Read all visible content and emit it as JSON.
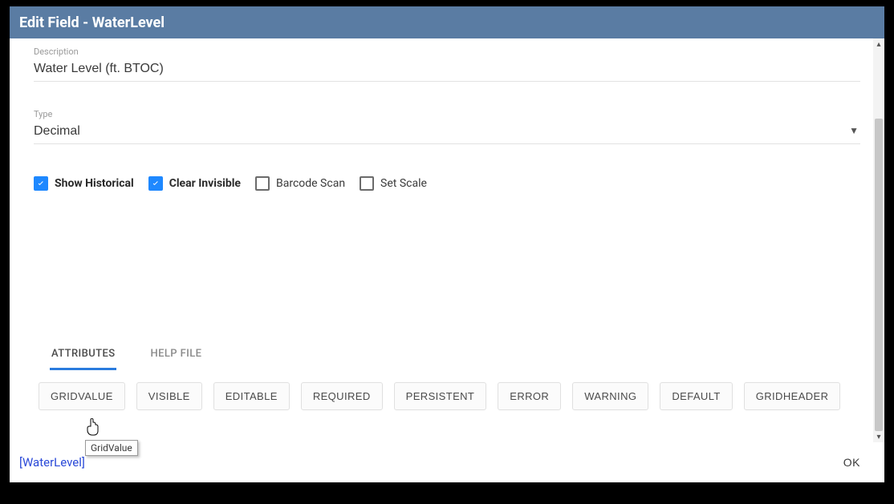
{
  "title": "Edit Field - WaterLevel",
  "fields": {
    "description": {
      "label": "Description",
      "value": "Water Level (ft. BTOC)"
    },
    "type": {
      "label": "Type",
      "value": "Decimal"
    }
  },
  "checks": {
    "show_historical": {
      "label": "Show Historical",
      "checked": true
    },
    "clear_invisible": {
      "label": "Clear Invisible",
      "checked": true
    },
    "barcode_scan": {
      "label": "Barcode Scan",
      "checked": false
    },
    "set_scale": {
      "label": "Set Scale",
      "checked": false
    }
  },
  "tabs": {
    "attributes": "ATTRIBUTES",
    "help_file": "HELP FILE"
  },
  "attr_buttons": [
    "GRIDVALUE",
    "VISIBLE",
    "EDITABLE",
    "REQUIRED",
    "PERSISTENT",
    "ERROR",
    "WARNING",
    "DEFAULT",
    "GRIDHEADER"
  ],
  "footer": {
    "link": "[WaterLevel]",
    "ok": "OK"
  },
  "tooltip": "GridValue"
}
